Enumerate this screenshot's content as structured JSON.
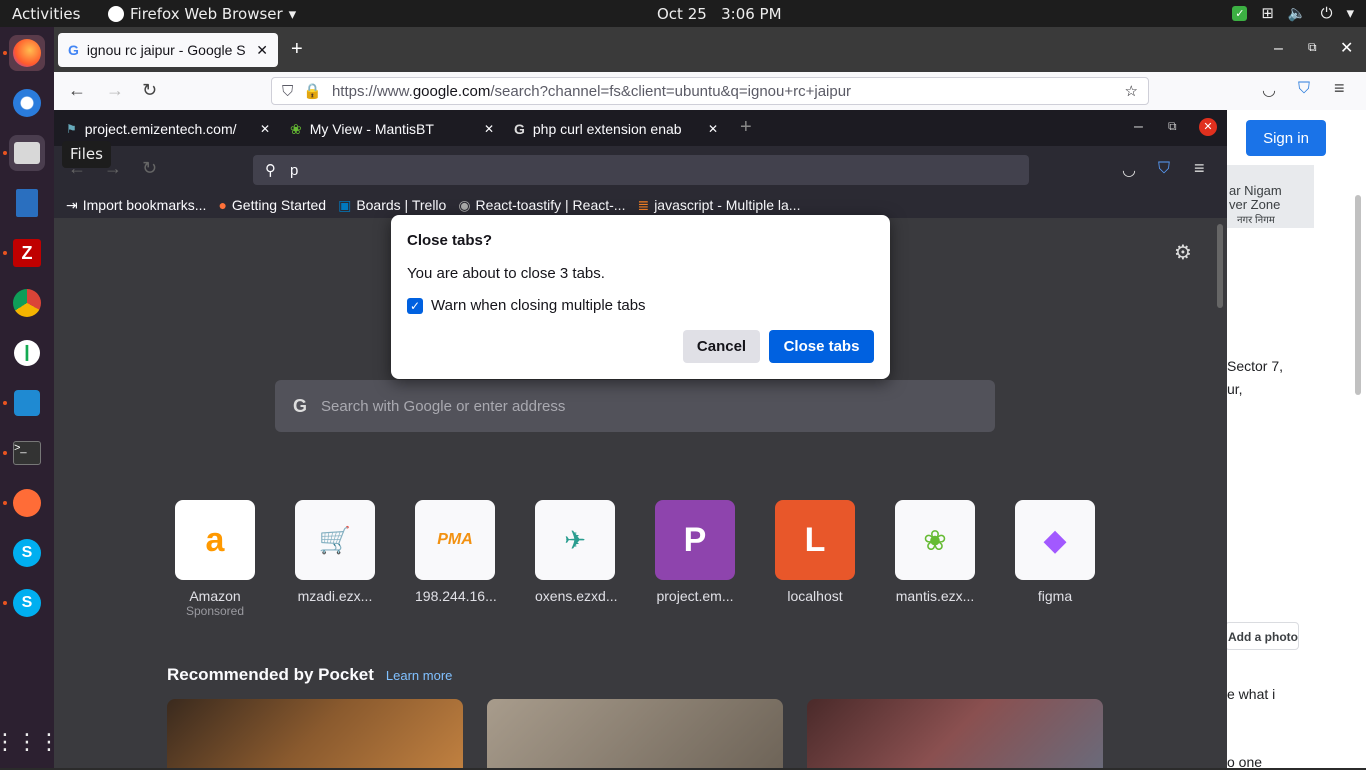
{
  "topbar": {
    "activities": "Activities",
    "app_name": "Firefox Web Browser",
    "clock_date": "Oct 25",
    "clock_time": "3:06 PM"
  },
  "dock": {
    "tooltip": "Files",
    "items": [
      "firefox-icon",
      "thunderbird-icon",
      "files-icon",
      "libreoffice-writer-icon",
      "filezilla-icon",
      "chrome-icon",
      "mongodb-compass-icon",
      "vscode-icon",
      "terminal-icon",
      "postman-icon",
      "skype-icon",
      "skype-icon"
    ],
    "show_apps": "show-apps-icon"
  },
  "outer": {
    "tab_title": "ignou rc jaipur - Google S",
    "url_prefix": "https://www.",
    "url_domain": "google.com",
    "url_rest": "/search?channel=fs&client=ubuntu&q=ignou+rc+jaipur",
    "sign_in": "Sign in",
    "side_map_1": "ar Nigam",
    "side_map_2": "ver Zone",
    "side_map_3": "नगर निगम",
    "side_text_1": "Sector 7,",
    "side_text_2": "ur,",
    "add_photo": "Add a photo",
    "side_text_3": "e what i",
    "side_text_4": "o one"
  },
  "inner": {
    "tabs": [
      {
        "label": "project.emizentech.com/",
        "icon": "emizentech-icon"
      },
      {
        "label": "My View - MantisBT",
        "icon": "mantis-icon"
      },
      {
        "label": "php curl extension enab",
        "icon": "google-icon"
      }
    ],
    "url_value": "p",
    "bookmarks": [
      {
        "label": "Import bookmarks...",
        "icon": "import-icon"
      },
      {
        "label": "Getting Started",
        "icon": "firefox-icon"
      },
      {
        "label": "Boards | Trello",
        "icon": "trello-icon"
      },
      {
        "label": "React-toastify | React-...",
        "icon": "react-toastify-icon"
      },
      {
        "label": "javascript - Multiple la...",
        "icon": "stackoverflow-icon"
      }
    ],
    "search_placeholder": "Search with Google or enter address",
    "tiles": [
      {
        "label": "Amazon",
        "sub": "Sponsored",
        "glyph": "a",
        "color": "#f90",
        "bg": "#ffffff"
      },
      {
        "label": "mzadi.ezx...",
        "sub": "",
        "glyph": "🛒",
        "color": "#333",
        "bg": "#f9f9fb"
      },
      {
        "label": "198.244.16...",
        "sub": "",
        "glyph": "PMA",
        "color": "#f29111",
        "bg": "#f9f9fb"
      },
      {
        "label": "oxens.ezxd...",
        "sub": "",
        "glyph": "✈",
        "color": "#2a9d8f",
        "bg": "#f9f9fb"
      },
      {
        "label": "project.em...",
        "sub": "",
        "glyph": "P",
        "color": "#ffffff",
        "bg": "#8e44ad"
      },
      {
        "label": "localhost",
        "sub": "",
        "glyph": "L",
        "color": "#ffffff",
        "bg": "#e8572a"
      },
      {
        "label": "mantis.ezx...",
        "sub": "",
        "glyph": "🦉",
        "color": "#333",
        "bg": "#f9f9fb"
      },
      {
        "label": "figma",
        "sub": "",
        "glyph": "◆",
        "color": "#a259ff",
        "bg": "#f9f9fb"
      }
    ],
    "pocket_title": "Recommended by Pocket",
    "pocket_learn": "Learn more"
  },
  "dialog": {
    "title": "Close tabs?",
    "message": "You are about to close 3 tabs.",
    "checkbox_label": "Warn when closing multiple tabs",
    "checkbox_checked": true,
    "cancel": "Cancel",
    "close": "Close tabs"
  }
}
